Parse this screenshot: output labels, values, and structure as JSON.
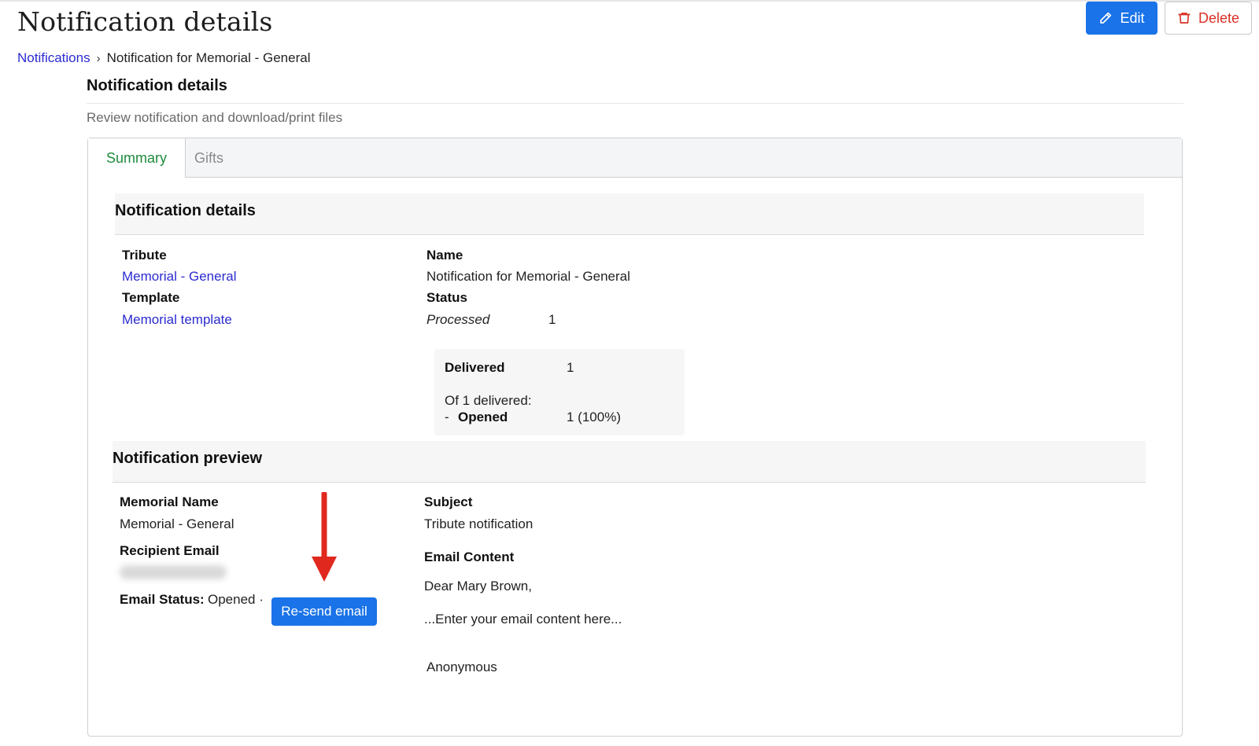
{
  "header": {
    "title": "Notification details",
    "edit_label": "Edit",
    "delete_label": "Delete"
  },
  "breadcrumb": {
    "parent": "Notifications",
    "separator": "›",
    "current": "Notification for Memorial - General"
  },
  "section": {
    "title": "Notification details",
    "subtitle": "Review notification and download/print files"
  },
  "tabs": [
    {
      "label": "Summary",
      "active": true
    },
    {
      "label": "Gifts",
      "active": false
    }
  ],
  "details": {
    "heading": "Notification details",
    "tribute_label": "Tribute",
    "tribute_value": "Memorial - General",
    "template_label": "Template",
    "template_value": "Memorial template",
    "name_label": "Name",
    "name_value": "Notification for Memorial - General",
    "status_label": "Status",
    "status_value": "Processed",
    "status_count": "1",
    "delivered_label": "Delivered",
    "delivered_count": "1",
    "of_delivered": "Of 1 delivered:",
    "opened_dash": "-",
    "opened_label": "Opened",
    "opened_value": "1 (100%)"
  },
  "preview": {
    "heading": "Notification preview",
    "memorial_name_label": "Memorial Name",
    "memorial_name_value": "Memorial - General",
    "recipient_email_label": "Recipient Email",
    "email_status_label": "Email Status:",
    "email_status_value": "Opened ·",
    "resend_label": "Re-send email",
    "subject_label": "Subject",
    "subject_value": "Tribute notification",
    "email_content_label": "Email Content",
    "greeting": "Dear Mary Brown,",
    "body": "...Enter your email content here...",
    "signature": "Anonymous"
  },
  "colors": {
    "primary": "#1a73e8",
    "danger": "#d93025",
    "link": "#2b2bd1",
    "active_tab": "#1e8a3c",
    "annotation_arrow": "#e0281f"
  },
  "icons": {
    "edit": "pencil-icon",
    "delete": "trash-icon",
    "separator": "chevron-right-icon",
    "annotation": "red-arrow-down-icon"
  }
}
